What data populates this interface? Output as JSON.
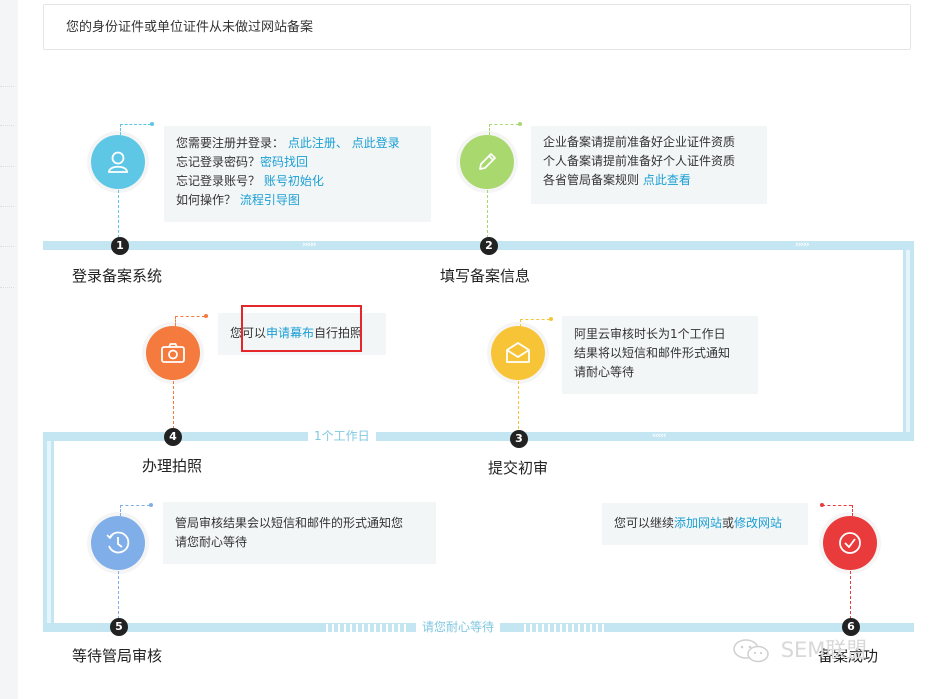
{
  "notice": {
    "text": "您的身份证件或单位证件从未做过网站备案"
  },
  "colors": {
    "track": "#c4e6f3",
    "link": "#1a9fd4",
    "step1": "#5fc7e6",
    "step2": "#a9d86e",
    "step3": "#f8c437",
    "step4": "#f47a3d",
    "step5": "#7faee8",
    "step6": "#e93a3c",
    "highlight_border": "#e5262b"
  },
  "steps": [
    {
      "num": "1",
      "title": "登录备案系统",
      "icon": "user-icon"
    },
    {
      "num": "2",
      "title": "填写备案信息",
      "icon": "pencil-icon"
    },
    {
      "num": "3",
      "title": "提交初审",
      "icon": "envelope-icon"
    },
    {
      "num": "4",
      "title": "办理拍照",
      "icon": "camera-icon"
    },
    {
      "num": "5",
      "title": "等待管局审核",
      "icon": "clock-icon"
    },
    {
      "num": "6",
      "title": "备案成功",
      "icon": "check-icon"
    }
  ],
  "box1": {
    "l1_text": "您需要注册并登录：",
    "l1_link1": "点此注册",
    "l1_sep": "、",
    "l1_link2": "点此登录",
    "l2_text": "忘记登录密码？",
    "l2_link": "密码找回",
    "l3_text": "忘记登录账号？",
    "l3_link": "账号初始化",
    "l4_text": "如何操作？",
    "l4_link": "流程引导图"
  },
  "box2": {
    "l1": "企业备案请提前准备好企业证件资质",
    "l2": "个人备案请提前准备好个人证件资质",
    "l3_text": "各省管局备案规则",
    "l3_link": "点此查看"
  },
  "box3": {
    "l1": "阿里云审核时长为1个工作日",
    "l2": "结果将以短信和邮件形式通知",
    "l3": "请耐心等待"
  },
  "box4": {
    "pre": "您可以",
    "link": "申请幕布",
    "post": "自行拍照"
  },
  "box5": {
    "l1": "管局审核结果会以短信和邮件的形式通知您",
    "l2": "请您耐心等待"
  },
  "box6": {
    "pre": "您可以继续",
    "link1": "添加网站",
    "mid": "或",
    "link2": "修改网站"
  },
  "track_labels": {
    "row2": "1个工作日",
    "row3": "请您耐心等待"
  },
  "chevrons": {
    "right": "›››››",
    "left": "‹‹‹‹‹"
  },
  "watermark": {
    "text": "SEM联盟"
  }
}
